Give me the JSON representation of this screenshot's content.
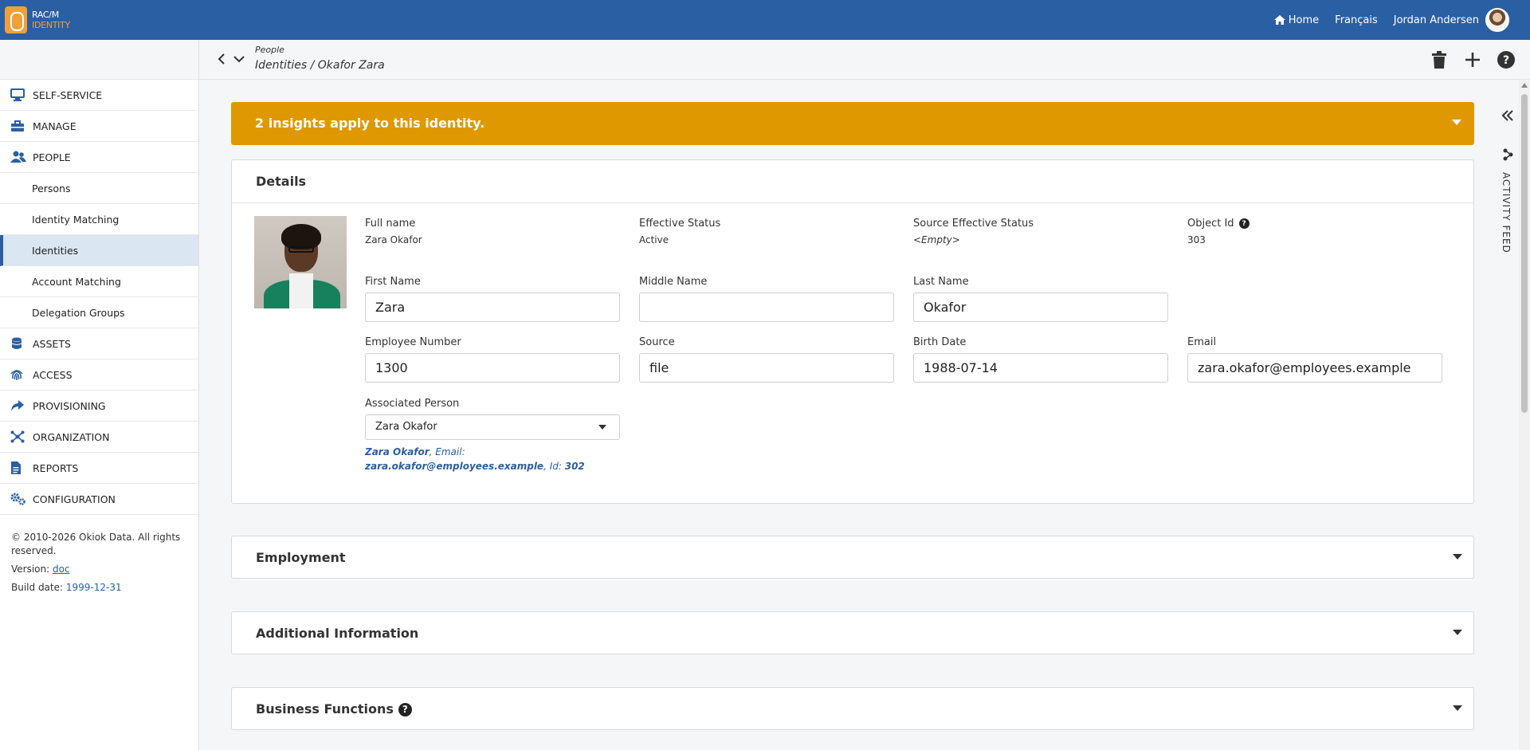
{
  "topbar": {
    "logo_line1": "RAC/M",
    "logo_line2": "IDENTITY",
    "home_label": "Home",
    "language_label": "Français",
    "user_name": "Jordan Andersen"
  },
  "sidebar": {
    "items": [
      {
        "label": "SELF-SERVICE",
        "icon": "monitor-icon"
      },
      {
        "label": "MANAGE",
        "icon": "toolbox-icon"
      },
      {
        "label": "PEOPLE",
        "icon": "people-icon"
      },
      {
        "label": "Persons"
      },
      {
        "label": "Identity Matching"
      },
      {
        "label": "Identities"
      },
      {
        "label": "Account Matching"
      },
      {
        "label": "Delegation Groups"
      },
      {
        "label": "ASSETS",
        "icon": "database-icon"
      },
      {
        "label": "ACCESS",
        "icon": "fingerprint-icon"
      },
      {
        "label": "PROVISIONING",
        "icon": "share-icon"
      },
      {
        "label": "ORGANIZATION",
        "icon": "hierarchy-icon"
      },
      {
        "label": "REPORTS",
        "icon": "report-icon"
      },
      {
        "label": "CONFIGURATION",
        "icon": "gears-icon"
      }
    ],
    "footer": {
      "copyright": "© 2010-2026 Okiok Data. All rights reserved.",
      "version_prefix": "Version:",
      "version_link": "doc",
      "build_prefix": "Build date:",
      "build_date": "1999-12-31"
    }
  },
  "header": {
    "breadcrumb_top": "People",
    "breadcrumb": "Identities / Okafor Zara"
  },
  "alert": {
    "text": "2 insights apply to this identity."
  },
  "details": {
    "title": "Details",
    "full_name_label": "Full name",
    "full_name": "Zara Okafor",
    "effective_status_label": "Effective Status",
    "effective_status": "Active",
    "source_status_label": "Source Effective Status",
    "source_status": "<Empty>",
    "object_id_label": "Object Id",
    "object_id": "303",
    "first_name_label": "First Name",
    "first_name": "Zara",
    "middle_name_label": "Middle Name",
    "middle_name": "",
    "last_name_label": "Last Name",
    "last_name": "Okafor",
    "employee_number_label": "Employee Number",
    "employee_number": "1300",
    "source_label": "Source",
    "source": "file",
    "birth_date_label": "Birth Date",
    "birth_date": "1988-07-14",
    "email_label": "Email",
    "email": "zara.okafor@employees.example",
    "associated_person_label": "Associated Person",
    "associated_person": "Zara Okafor",
    "assoc_name": "Zara Okafor",
    "assoc_email_prefix": ", Email: ",
    "assoc_email": "zara.okafor@employees.example",
    "assoc_id_prefix": ", Id: ",
    "assoc_id": "302"
  },
  "sections": {
    "employment": "Employment",
    "additional": "Additional Information",
    "business": "Business Functions"
  },
  "activity_feed": {
    "label": "ACTIVITY FEED"
  },
  "colors": {
    "brand": "#2b5fa3",
    "accent": "#f0a03a",
    "alert": "#e09800"
  }
}
